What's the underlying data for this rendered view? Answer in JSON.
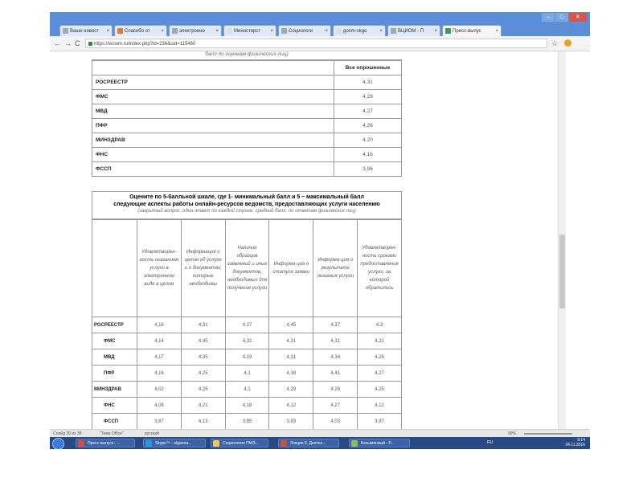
{
  "browser": {
    "tabs": [
      {
        "label": "Ваше новост"
      },
      {
        "label": "Спасибо от"
      },
      {
        "label": "электронно"
      },
      {
        "label": "Министерст"
      },
      {
        "label": "Социологи"
      },
      {
        "label": "gosm-skgo"
      },
      {
        "label": "ВЦИОМ - П"
      },
      {
        "label": "Пресс-выпус"
      }
    ],
    "url": "https://wciom.ru/index.php?id=236&uid=115460",
    "window_buttons": {
      "minimize": "–",
      "maximize": "□",
      "close": "✕"
    }
  },
  "page": {
    "top_note": "балл по оценкам физических лиц)",
    "table1": {
      "header": "Все опрошенные",
      "rows": [
        {
          "name": "РОСРЕЕСТР",
          "value": "4,31"
        },
        {
          "name": "ФМС",
          "value": "4,29"
        },
        {
          "name": "МВД",
          "value": "4,27"
        },
        {
          "name": "ПФР",
          "value": "4,26"
        },
        {
          "name": "МИНЗДРАВ",
          "value": "4,20"
        },
        {
          "name": "ФНС",
          "value": "4,16"
        },
        {
          "name": "ФССП",
          "value": "3,96"
        }
      ]
    },
    "question": {
      "line1": "Оцените по 5-балльной шкале, где 1- минимальный балл и 5 – максимальный балл",
      "line2": "следующие аспекты работы онлайн-ресурсов ведомств, предоставляющих услуги населению",
      "line3": "(закрытый вопрос, один ответ по каждой строке, средний балл, по ответам физических лиц)"
    },
    "table2": {
      "columns": [
        "Удовлетворен-ность оказанием услуги в электронном виде в целом",
        "Информация о целом об услуге и о документах, которые необходимы",
        "Наличие образцов заявлений и иных документов, необходимых для получения услуги",
        "Информа-ция о статусе заявки",
        "Информа-ция о результате оказания услуги",
        "Удовлетворен-ность сроками предоставления услуги, за которой обратились"
      ],
      "rows": [
        {
          "name": "РОСРЕЕСТР",
          "values": [
            "4,16",
            "4,31",
            "4,27",
            "4,45",
            "4,37",
            "4,3"
          ]
        },
        {
          "name": "ФМС",
          "values": [
            "4,14",
            "4,45",
            "4,32",
            "4,31",
            "4,31",
            "4,22"
          ]
        },
        {
          "name": "МВД",
          "values": [
            "4,17",
            "4,35",
            "4,19",
            "4,31",
            "4,34",
            "4,26"
          ]
        },
        {
          "name": "ПФР",
          "values": [
            "4,16",
            "4,25",
            "4,1",
            "4,38",
            "4,41",
            "4,27"
          ]
        },
        {
          "name": "МИНЗДРАВ",
          "values": [
            "4,02",
            "4,26",
            "4,1",
            "4,29",
            "4,28",
            "4,25"
          ]
        },
        {
          "name": "ФНС",
          "values": [
            "4,08",
            "4,21",
            "4,18",
            "4,12",
            "4,27",
            "4,12"
          ]
        },
        {
          "name": "ФССП",
          "values": [
            "3,87",
            "4,13",
            "3,85",
            "3,93",
            "4,03",
            "3,97"
          ]
        }
      ]
    }
  },
  "statusbar": {
    "left": "Слайд 30 из 38",
    "theme": "\"Тема Office\"",
    "lang": "русский",
    "zoom": "99%"
  },
  "taskbar": {
    "items": [
      {
        "label": "Пресс-выпуск - ..."
      },
      {
        "label": "Skype™ - olganna..."
      },
      {
        "label": "Социология ПМЭ..."
      },
      {
        "label": "Лекция 6. Деятел..."
      },
      {
        "label": "Безымянный - Р..."
      }
    ],
    "lang": "RU",
    "time": "9:14",
    "date": "24.11.2016"
  },
  "colors": {
    "taskbar": "#274a86",
    "tabbar": "#5a8fd8"
  }
}
